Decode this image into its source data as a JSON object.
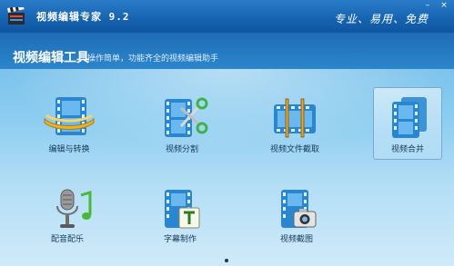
{
  "window": {
    "title": "视频编辑专家 9.2",
    "minimize_icon": "minimize-icon",
    "close_icon": "close-icon",
    "minimize_glyph": "–",
    "close_glyph": "×"
  },
  "slogan": "专业、易用、免费",
  "header": {
    "title": "视频编辑工具",
    "description": "操作简单，功能齐全的视频编辑助手"
  },
  "tools": [
    {
      "label": "编辑与转换",
      "icon": "film-edit-convert-icon"
    },
    {
      "label": "视频分割",
      "icon": "film-scissors-icon"
    },
    {
      "label": "视频文件截取",
      "icon": "film-trim-icon"
    },
    {
      "label": "视频合并",
      "icon": "film-merge-icon",
      "selected": true
    },
    {
      "label": "配音配乐",
      "icon": "microphone-icon"
    },
    {
      "label": "字幕制作",
      "icon": "subtitle-icon"
    },
    {
      "label": "视频截图",
      "icon": "film-camera-icon"
    }
  ],
  "colors": {
    "titlebar": "#1765b2",
    "background": "#8dcdf0",
    "film": "#2b86d2",
    "label_text": "#163a5a"
  }
}
